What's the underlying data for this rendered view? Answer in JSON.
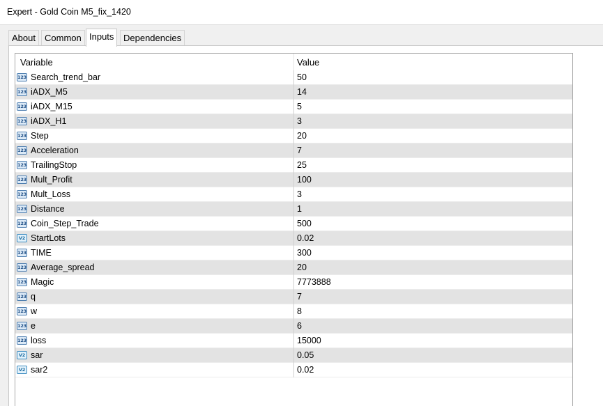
{
  "window": {
    "title": "Expert - Gold Coin M5_fix_1420"
  },
  "tabs": [
    {
      "label": "About"
    },
    {
      "label": "Common"
    },
    {
      "label": "Inputs",
      "active": true
    },
    {
      "label": "Dependencies"
    }
  ],
  "table": {
    "headers": {
      "variable": "Variable",
      "value": "Value"
    },
    "rows": [
      {
        "icon": "integer-icon",
        "icon_text": "123",
        "name": "Search_trend_bar",
        "value": "50"
      },
      {
        "icon": "integer-icon",
        "icon_text": "123",
        "name": "iADX_M5",
        "value": "14"
      },
      {
        "icon": "integer-icon",
        "icon_text": "123",
        "name": "iADX_M15",
        "value": "5"
      },
      {
        "icon": "integer-icon",
        "icon_text": "123",
        "name": "iADX_H1",
        "value": "3"
      },
      {
        "icon": "integer-icon",
        "icon_text": "123",
        "name": "Step",
        "value": "20"
      },
      {
        "icon": "integer-icon",
        "icon_text": "123",
        "name": "Acceleration",
        "value": "7"
      },
      {
        "icon": "integer-icon",
        "icon_text": "123",
        "name": "TrailingStop",
        "value": "25"
      },
      {
        "icon": "integer-icon",
        "icon_text": "123",
        "name": "Mult_Profit",
        "value": "100"
      },
      {
        "icon": "integer-icon",
        "icon_text": "123",
        "name": "Mult_Loss",
        "value": "3"
      },
      {
        "icon": "integer-icon",
        "icon_text": "123",
        "name": "Distance",
        "value": "1"
      },
      {
        "icon": "integer-icon",
        "icon_text": "123",
        "name": "Coin_Step_Trade",
        "value": "500"
      },
      {
        "icon": "double-icon",
        "icon_text": "V2",
        "name": "StartLots",
        "value": "0.02"
      },
      {
        "icon": "integer-icon",
        "icon_text": "123",
        "name": "TIME",
        "value": "300"
      },
      {
        "icon": "integer-icon",
        "icon_text": "123",
        "name": "Average_spread",
        "value": "20"
      },
      {
        "icon": "integer-icon",
        "icon_text": "123",
        "name": "Magic",
        "value": "7773888"
      },
      {
        "icon": "integer-icon",
        "icon_text": "123",
        "name": "q",
        "value": "7"
      },
      {
        "icon": "integer-icon",
        "icon_text": "123",
        "name": "w",
        "value": "8"
      },
      {
        "icon": "integer-icon",
        "icon_text": "123",
        "name": "e",
        "value": "6"
      },
      {
        "icon": "integer-icon",
        "icon_text": "123",
        "name": "loss",
        "value": "15000"
      },
      {
        "icon": "double-icon",
        "icon_text": "V2",
        "name": "sar",
        "value": "0.05"
      },
      {
        "icon": "double-icon",
        "icon_text": "V2",
        "name": "sar2",
        "value": "0.02"
      }
    ]
  }
}
